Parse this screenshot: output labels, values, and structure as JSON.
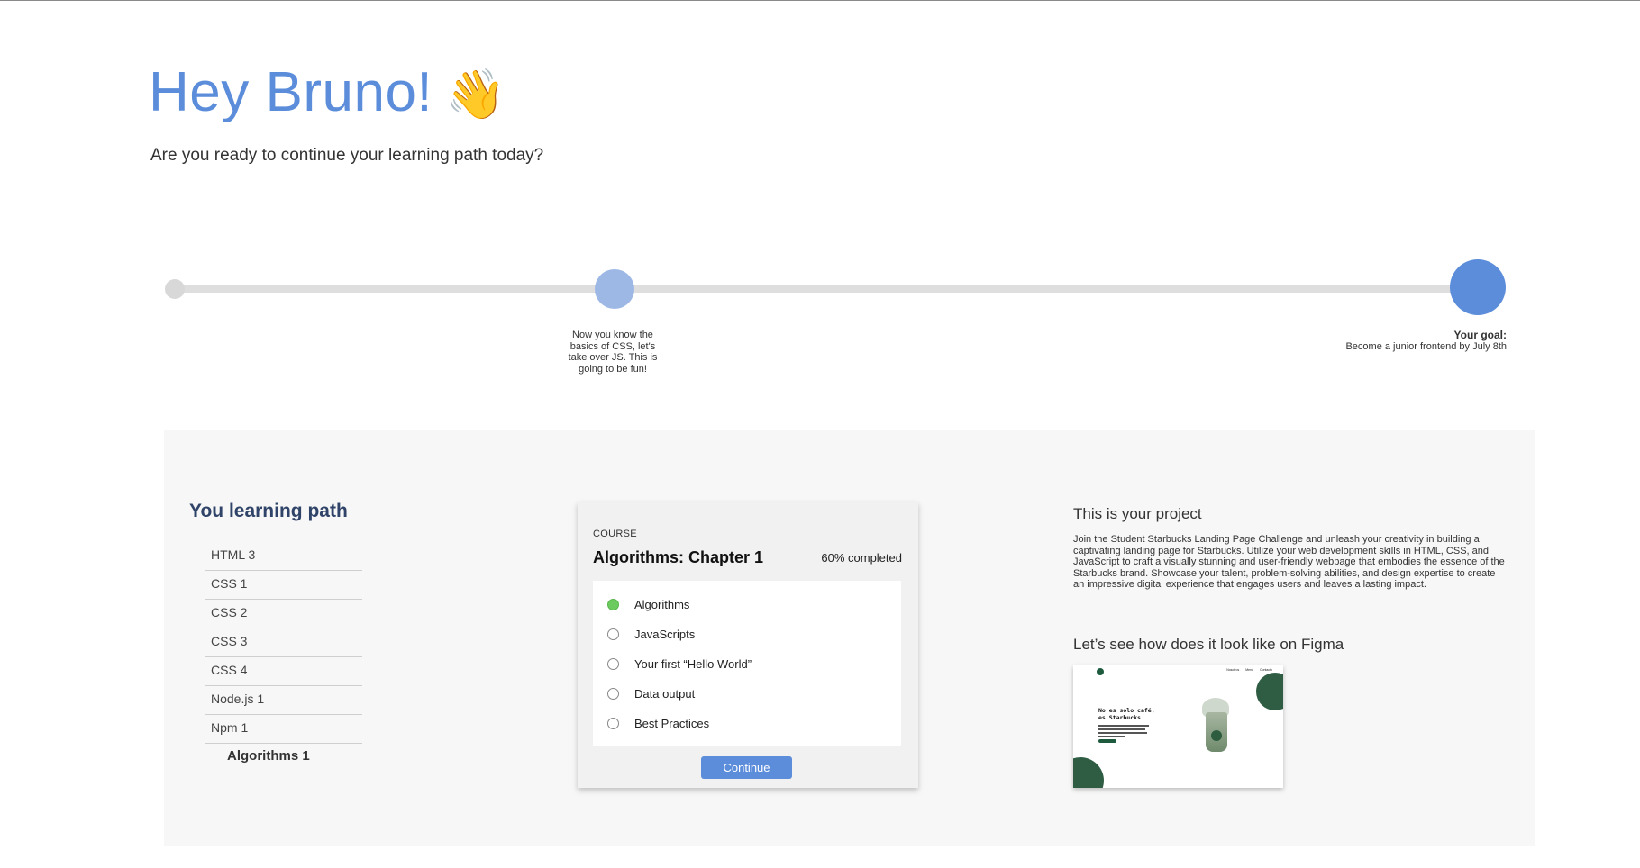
{
  "greeting": {
    "title": "Hey Bruno!",
    "wave_emoji": "👋",
    "subtitle": "Are you ready to continue your learning path today?"
  },
  "timeline": {
    "progress_fraction": 0.33,
    "milestone_note": "Now you know the basics of CSS, let's take over JS. This is going to be fun!",
    "goal_title": "Your goal:",
    "goal_text": "Become a junior frontend by July 8th"
  },
  "learning_path": {
    "title": "You learning path",
    "items": [
      {
        "label": "HTML 3"
      },
      {
        "label": "CSS 1"
      },
      {
        "label": "CSS 2"
      },
      {
        "label": "CSS 3"
      },
      {
        "label": "CSS 4"
      },
      {
        "label": "Node.js 1"
      },
      {
        "label": "Npm 1"
      },
      {
        "label": "Algorithms 1"
      }
    ]
  },
  "course": {
    "label": "COURSE",
    "title": "Algorithms: Chapter 1",
    "progress": "60% completed",
    "lessons": [
      {
        "label": "Algorithms",
        "done": true
      },
      {
        "label": "JavaScripts",
        "done": false
      },
      {
        "label": "Your first “Hello World”",
        "done": false
      },
      {
        "label": "Data output",
        "done": false
      },
      {
        "label": "Best Practices",
        "done": false
      }
    ],
    "continue_label": "Continue"
  },
  "project": {
    "title": "This is your project",
    "description": "Join the Student Starbucks Landing Page Challenge and unleash your creativity in building a captivating landing page for Starbucks. Utilize your web development skills in HTML, CSS, and JavaScript to craft a visually stunning and user-friendly webpage that embodies the essence of the Starbucks brand. Showcase your talent, problem-solving abilities, and design expertise to create an impressive digital experience that engages users and leaves a lasting impact.",
    "figma_title": "Let’s see how does it look like on Figma",
    "preview": {
      "headline": "No es solo café, es Starbucks",
      "nav": [
        "Nosotros",
        "Menú",
        "Contacto"
      ]
    }
  },
  "colors": {
    "accent": "#5b8ddb",
    "accent_light": "#9eb8e6",
    "heading_dark": "#2f4468",
    "done_green": "#6ccb5f",
    "brand_green": "#2f5d43"
  }
}
